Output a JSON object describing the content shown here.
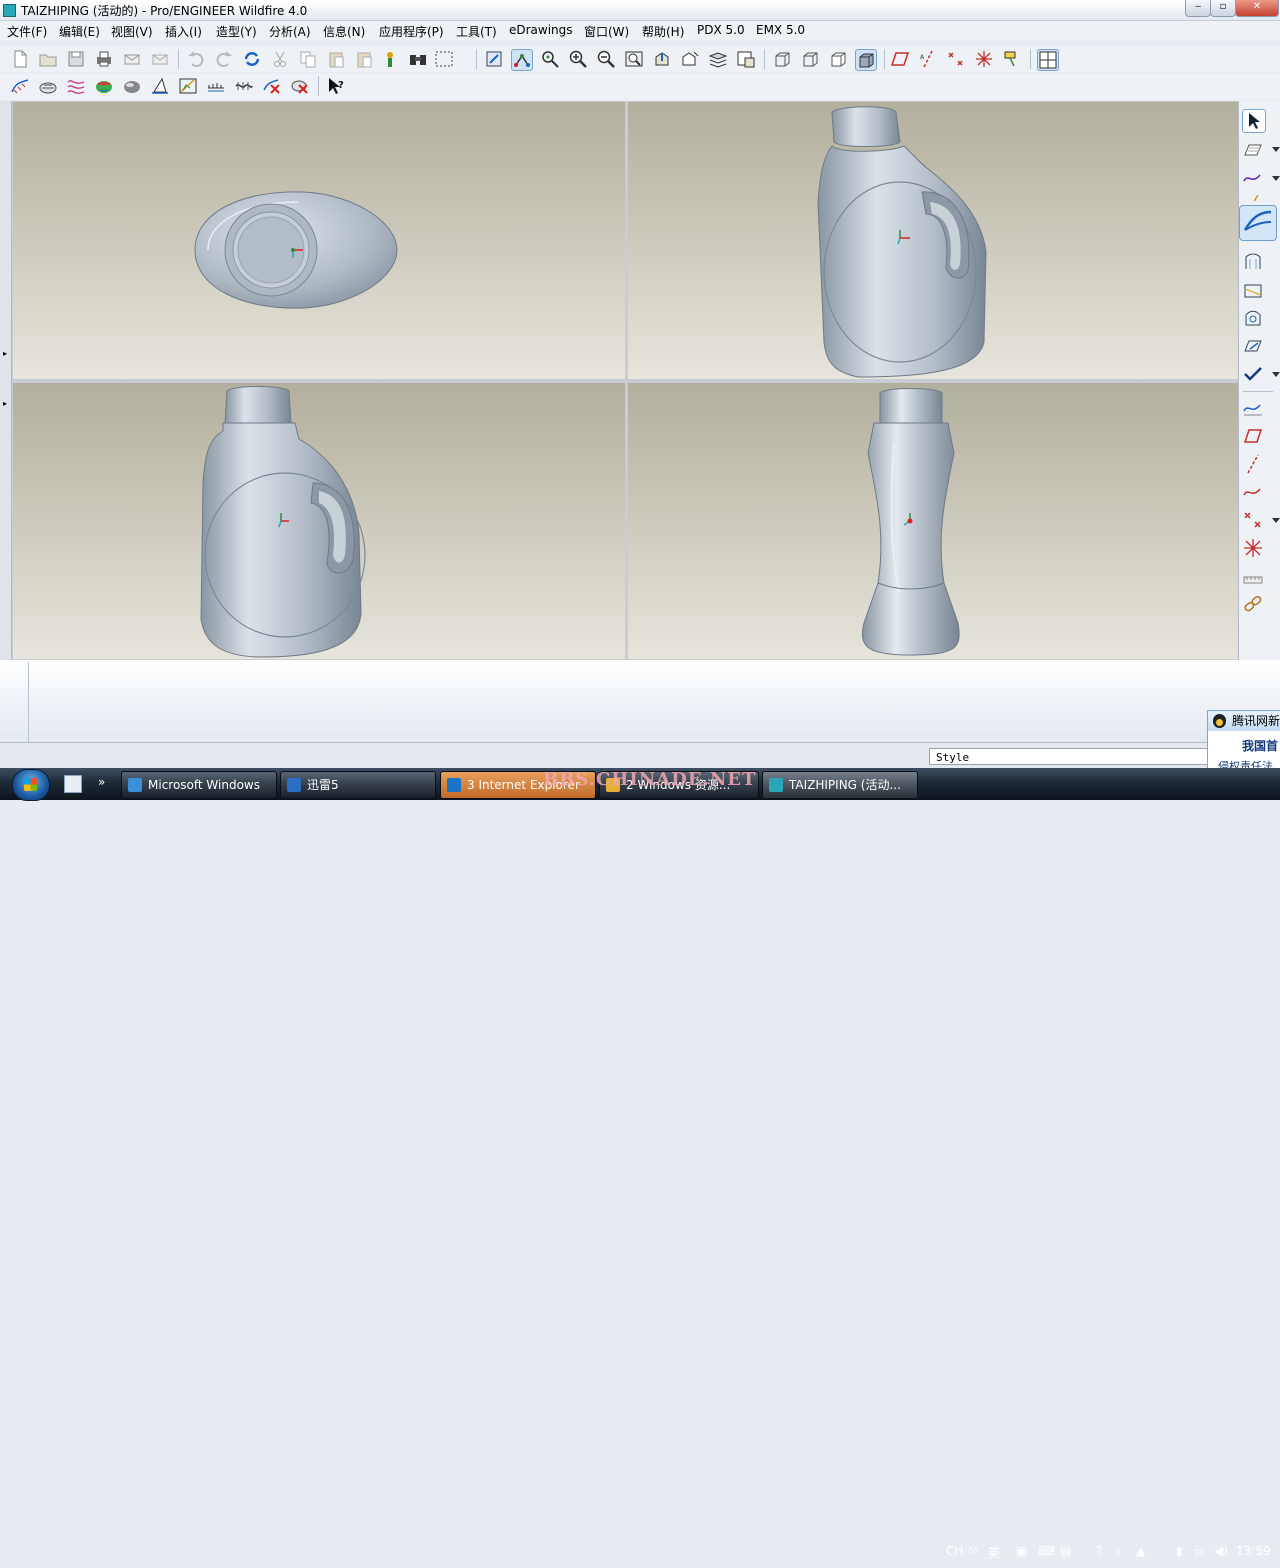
{
  "window": {
    "title": "TAIZHIPING (活动的) - Pro/ENGINEER Wildfire 4.0",
    "min_label": "‒",
    "max_label": "▫",
    "close_label": "✕"
  },
  "menubar": {
    "items": [
      "文件(F)",
      "编辑(E)",
      "视图(V)",
      "插入(I)",
      "造型(Y)",
      "分析(A)",
      "信息(N)",
      "应用程序(P)",
      "工具(T)",
      "eDrawings",
      "窗口(W)",
      "帮助(H)",
      "PDX 5.0",
      "EMX 5.0"
    ]
  },
  "toolbar1": {
    "icons": [
      "new-icon",
      "open-icon",
      "save-icon",
      "print-icon",
      "send-mail-icon",
      "send-icon",
      "undo-icon",
      "redo-icon",
      "regenerate-icon",
      "cut-icon",
      "copy-icon",
      "paste-icon",
      "paste-special-icon",
      "model-tree-icon",
      "find-icon",
      "select-box-icon",
      "sketch-plane-icon",
      "spin-center-icon",
      "orient-icon",
      "zoom-in-icon",
      "zoom-out-icon",
      "refit-icon",
      "reorient-icon",
      "saved-views-icon",
      "layers-icon",
      "view-manager-icon",
      "wireframe-icon",
      "hidden-line-icon",
      "no-hidden-icon",
      "shading-icon",
      "datum-plane-icon",
      "datum-axis-icon",
      "datum-point-icon",
      "coordinate-system-icon",
      "annotation-icon",
      "four-view-icon"
    ]
  },
  "toolbar2": {
    "icons": [
      "curve-analysis-icon",
      "surface-analysis-icon",
      "reflection-icon",
      "draft-analysis-icon",
      "shade-analysis-icon",
      "slope-icon",
      "dihedral-icon",
      "offset-icon",
      "deviation-icon",
      "delete-analysis-icon",
      "delete-all-icon",
      "whats-this-icon"
    ]
  },
  "viewports": [
    {
      "name": "top-view"
    },
    {
      "name": "iso-view"
    },
    {
      "name": "front-view"
    },
    {
      "name": "side-view"
    }
  ],
  "rightbar": {
    "icons": [
      "select-arrow-icon",
      "plane-icon",
      "curve-icon",
      "point-icon",
      "style-icon",
      "surface-icon",
      "boundary-icon",
      "trim-icon",
      "offset-surface-icon",
      "done-check-icon",
      "analysis-curve-icon",
      "datum-plane-small-icon",
      "datum-axis-small-icon",
      "sketch-curve-icon",
      "datum-point-small-icon",
      "csys-icon",
      "ruler-icon",
      "chain-icon"
    ]
  },
  "statusbar": {
    "style_label": "Style"
  },
  "qq_popup": {
    "title": "腾讯网新",
    "line1": "我国首",
    "line2": "侵权责任法"
  },
  "taskbar": {
    "buttons": [
      {
        "label": "Microsoft Windows",
        "color": "#3a8fd6"
      },
      {
        "label": "迅雷5",
        "color": "#2a6fc2"
      },
      {
        "label": "3 Internet Explorer",
        "color": "#1a73c9"
      },
      {
        "label": "2 Windows 资源...",
        "color": "#e5b03a"
      },
      {
        "label": "TAIZHIPING (活动...",
        "color": "#2aa7b8"
      }
    ],
    "watermark": "BBS.CHINADE.NET",
    "tray": {
      "lang": "CH",
      "ime": "英",
      "time": "13:59"
    }
  },
  "colors": {
    "viewport_top": "#b3af9d",
    "viewport_bottom": "#e7e5dc",
    "model": "#aeb9c4",
    "accent": "#7aa6d2"
  }
}
